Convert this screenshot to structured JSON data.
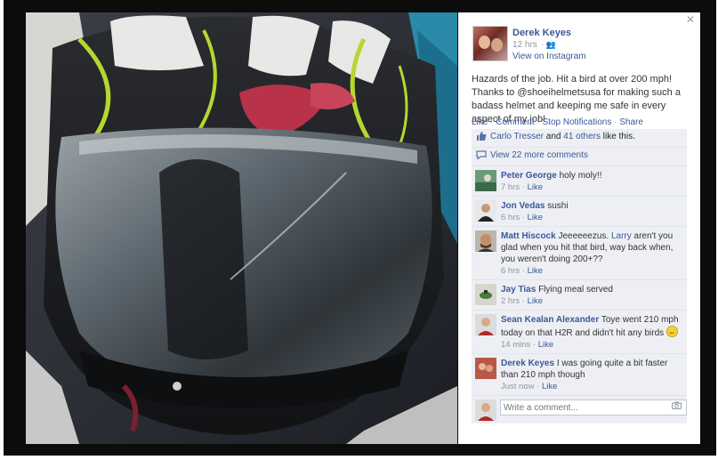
{
  "post": {
    "author": "Derek Keyes",
    "time": "12 hrs",
    "audience_icon": "friends-icon",
    "via": "View on Instagram",
    "text": "Hazards of the job. Hit a bird at over 200 mph! Thanks to @shoeihelmetsusa for making such a badass helmet and keeping me safe in every aspect of my job!"
  },
  "actions": {
    "like": "Like",
    "comment": "Comment",
    "notifications": "Stop Notifications",
    "share": "Share",
    "separator": " · "
  },
  "likes": {
    "name": "Carlo Tresser",
    "and": " and ",
    "others": "41 others",
    "suffix": " like this."
  },
  "more_comments": "View 22 more comments",
  "comments": [
    {
      "name": "Peter George",
      "text": " holy moly!!",
      "time": "7 hrs",
      "like": "Like"
    },
    {
      "name": "Jon Vedas",
      "text": " sushi",
      "time": "6 hrs",
      "like": "Like"
    },
    {
      "name": "Matt Hiscock",
      "text_before": " Jeeeeeezus. ",
      "mention": "Larry",
      "text_after": " aren't you glad when you hit that bird, way back when, you weren't doing 200+??",
      "time": "6 hrs",
      "like": "Like"
    },
    {
      "name": "Jay Tias",
      "text": " Flying meal served",
      "time": "2 hrs",
      "like": "Like"
    },
    {
      "name": "Sean Kealan Alexander",
      "text": " Toye went 210 mph today on that H2R and didn't hit any birds ",
      "time": "14 mins",
      "like": "Like"
    },
    {
      "name": "Derek Keyes",
      "text": " I was going quite a bit faster than 210 mph though",
      "time": "Just now",
      "like": "Like"
    }
  ],
  "comment_box": {
    "placeholder": "Write a comment...",
    "icon": "camera-icon"
  },
  "colors": {
    "link": "#3b5998",
    "overlay": "#0c0c0c",
    "ufi_bg": "#edeff4"
  }
}
